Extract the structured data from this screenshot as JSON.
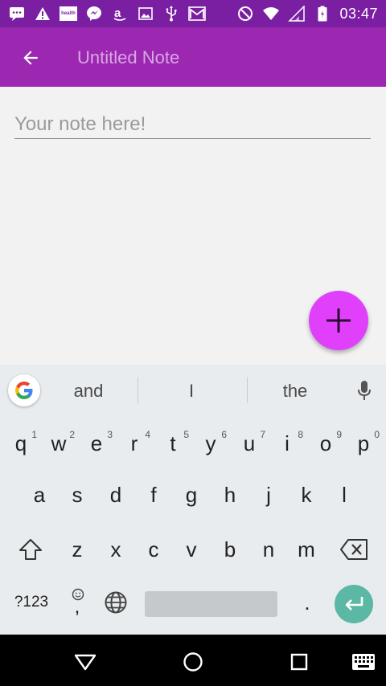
{
  "status_bar": {
    "time": "03:47",
    "left_icons": [
      "chat-icon",
      "warning-icon",
      "health-icon",
      "messenger-icon",
      "amazon-icon",
      "image-icon",
      "usb-icon",
      "gmail-icon"
    ],
    "right_icons": [
      "do-not-disturb-icon",
      "wifi-icon",
      "signal-icon",
      "battery-icon"
    ],
    "health_label": "health"
  },
  "app_bar": {
    "title": "Untitled Note",
    "background": "#9c27b0",
    "status_background": "#7b1fa2"
  },
  "editor": {
    "placeholder": "Your note here!",
    "value": ""
  },
  "fab": {
    "icon": "plus-icon",
    "color": "#e040fb"
  },
  "suggestions": {
    "items": [
      "and",
      "I",
      "the"
    ]
  },
  "keyboard": {
    "row1": [
      "q",
      "w",
      "e",
      "r",
      "t",
      "y",
      "u",
      "i",
      "o",
      "p"
    ],
    "row1_hints": [
      "1",
      "2",
      "3",
      "4",
      "5",
      "6",
      "7",
      "8",
      "9",
      "0"
    ],
    "row2": [
      "a",
      "s",
      "d",
      "f",
      "g",
      "h",
      "j",
      "k",
      "l"
    ],
    "row3": [
      "z",
      "x",
      "c",
      "v",
      "b",
      "n",
      "m"
    ],
    "symbols_label": "?123",
    "comma": ",",
    "period": ".",
    "enter_color": "#5bb8a4"
  }
}
